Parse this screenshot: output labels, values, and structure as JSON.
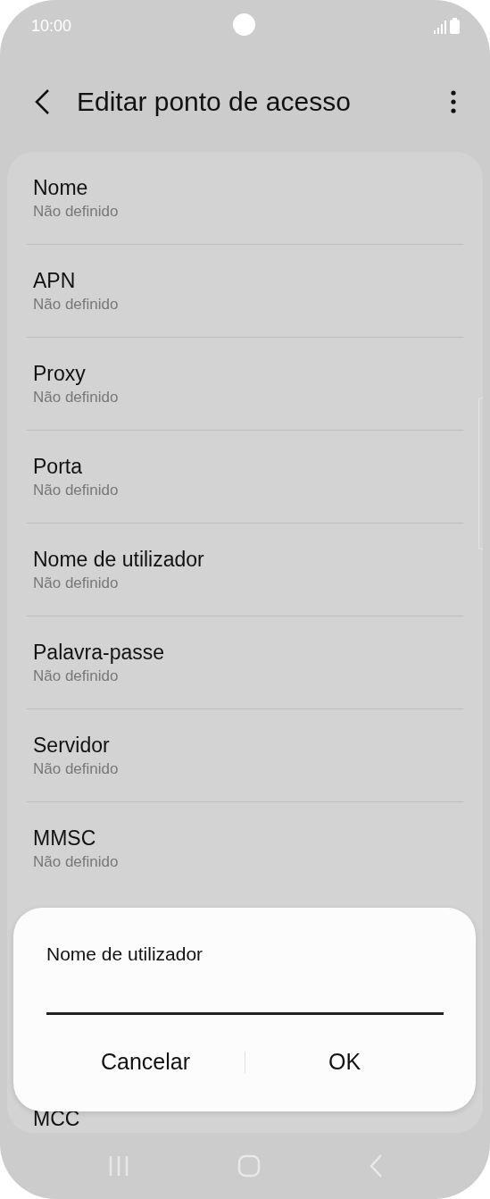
{
  "status_bar": {
    "time": "10:00"
  },
  "header": {
    "title": "Editar ponto de acesso"
  },
  "settings": [
    {
      "title": "Nome",
      "value": "Não definido"
    },
    {
      "title": "APN",
      "value": "Não definido"
    },
    {
      "title": "Proxy",
      "value": "Não definido"
    },
    {
      "title": "Porta",
      "value": "Não definido"
    },
    {
      "title": "Nome de utilizador",
      "value": "Não definido"
    },
    {
      "title": "Palavra-passe",
      "value": "Não definido"
    },
    {
      "title": "Servidor",
      "value": "Não definido"
    },
    {
      "title": "MMSC",
      "value": "Não definido"
    }
  ],
  "covered_item": {
    "title": "MCC"
  },
  "dialog": {
    "title": "Nome de utilizador",
    "buttons": [
      "Cancelar",
      "OK"
    ]
  }
}
